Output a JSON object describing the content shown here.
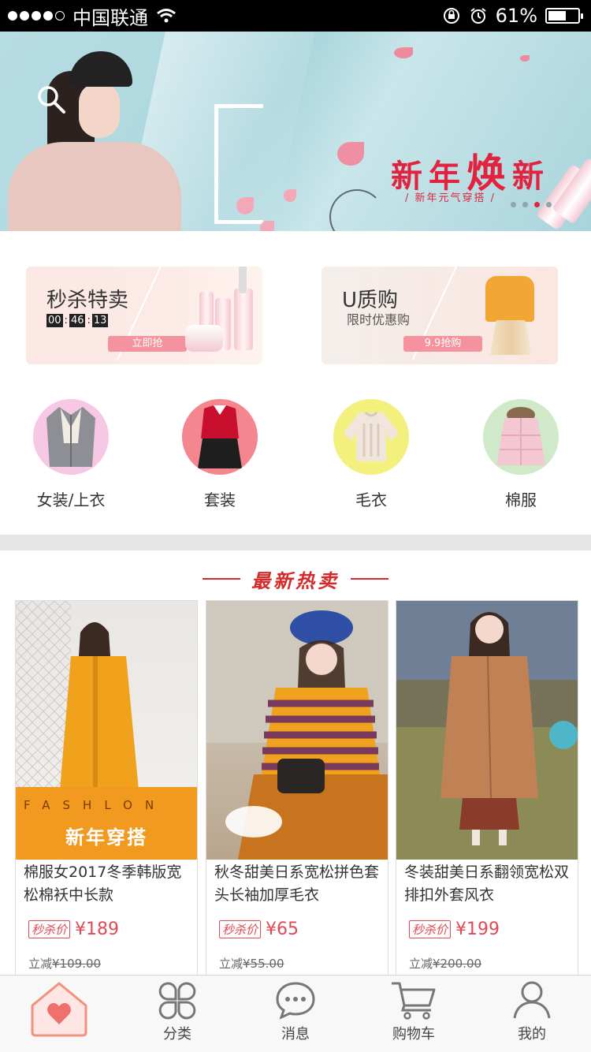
{
  "status_bar": {
    "carrier": "中国联通",
    "battery": "61%",
    "battery_level": 0.61
  },
  "banner": {
    "title_part1": "新年",
    "title_big": "焕",
    "title_part2": "新",
    "subtitle": "/ 新年元气穿搭 /",
    "dots": 4,
    "active_dot": 2,
    "accent_color": "#e2233f"
  },
  "promos": [
    {
      "title": "秒杀特卖",
      "timer": [
        "00",
        "46",
        "13"
      ],
      "button": "立即抢"
    },
    {
      "title": "U质购",
      "subtitle": "限时优惠购",
      "button": "9.9抢购"
    }
  ],
  "categories": [
    {
      "label": "女装/上衣",
      "bg": "#f7c8e6"
    },
    {
      "label": "套装",
      "bg": "#f3868f"
    },
    {
      "label": "毛衣",
      "bg": "#f3f07e"
    },
    {
      "label": "棉服",
      "bg": "#cfe9c9"
    }
  ],
  "section_title": "最新热卖",
  "products": [
    {
      "name": "棉服女2017冬季韩版宽松棉袄中长款",
      "tag": "秒杀价",
      "price": "¥189",
      "discount_label": "立减",
      "original_price": "¥109.00",
      "band_top": "FASHLON",
      "band_bottom": "新年穿搭"
    },
    {
      "name": "秋冬甜美日系宽松拼色套头长袖加厚毛衣",
      "tag": "秒杀价",
      "price": "¥65",
      "discount_label": "立减",
      "original_price": "¥55.00"
    },
    {
      "name": "冬装甜美日系翻领宽松双排扣外套风衣",
      "tag": "秒杀价",
      "price": "¥199",
      "discount_label": "立减",
      "original_price": "¥200.00"
    }
  ],
  "tabs": [
    {
      "label": "",
      "icon": "home-icon",
      "active": true
    },
    {
      "label": "分类",
      "icon": "category-icon"
    },
    {
      "label": "消息",
      "icon": "message-icon"
    },
    {
      "label": "购物车",
      "icon": "cart-icon"
    },
    {
      "label": "我的",
      "icon": "user-icon"
    }
  ]
}
